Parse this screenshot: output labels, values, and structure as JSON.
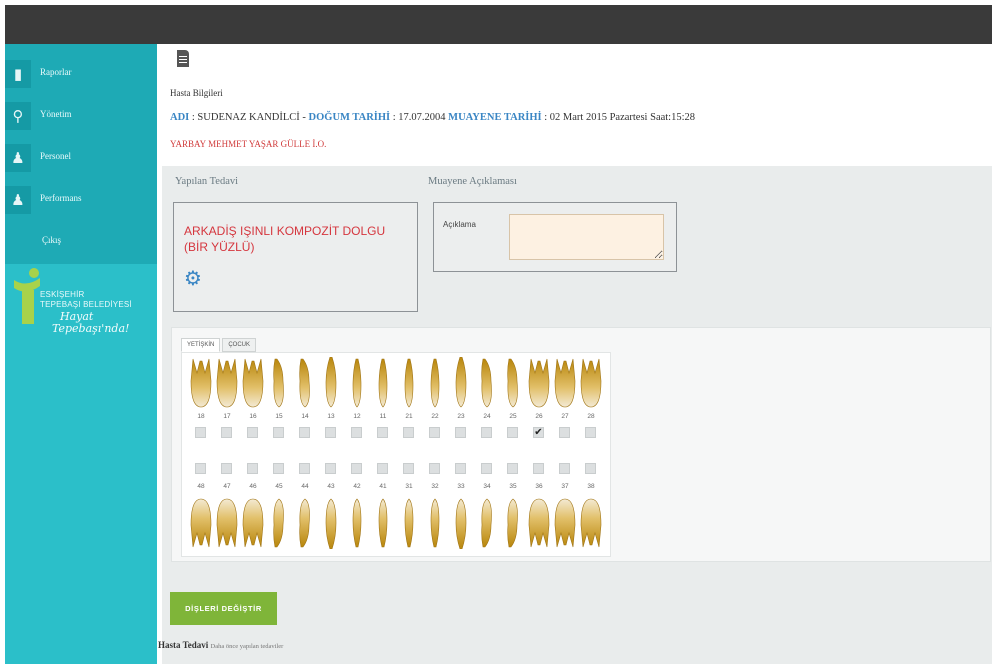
{
  "sidebar": {
    "items": [
      {
        "label": "Raporlar",
        "icon": "document-icon"
      },
      {
        "label": "Yönetim",
        "icon": "key-icon"
      },
      {
        "label": "Personel",
        "icon": "user-group-icon"
      },
      {
        "label": "Performans",
        "icon": "user-group-icon"
      },
      {
        "label": "Çıkış",
        "icon": ""
      }
    ],
    "logo": {
      "line1": "ESKİŞEHİR",
      "line2": "TEPEBAŞI BELEDİYESİ",
      "script1": "Hayat",
      "script2": "Tepebaşı'nda!"
    }
  },
  "patient": {
    "section_title": "Hasta Bilgileri",
    "name_label": "ADI",
    "name_value": " : SUDENAZ KANDİLCİ - ",
    "birth_label": "DOĞUM TARİHİ",
    "birth_value": " : 17.07.2004 ",
    "exam_label": "MUAYENE TARİHİ",
    "exam_value": " : 02 Mart 2015 Pazartesi Saat:15:28",
    "clinic": "YARBAY MEHMET YAŞAR GÜLLE İ.O."
  },
  "treatment": {
    "section_label": "Yapılan Tedavi",
    "text": "ARKADİŞ IŞINLI KOMPOZİT DOLGU (BİR YÜZLÜ)"
  },
  "exam_notes": {
    "section_label": "Muayene Açıklaması",
    "field_label": "Açıklama",
    "value": ""
  },
  "teeth": {
    "tabs": [
      {
        "label": "YETİŞKİN",
        "active": true
      },
      {
        "label": "ÇOCUK",
        "active": false
      }
    ],
    "upper": [
      {
        "num": "18",
        "checked": false,
        "shape": "molar"
      },
      {
        "num": "17",
        "checked": false,
        "shape": "molar"
      },
      {
        "num": "16",
        "checked": false,
        "shape": "molar"
      },
      {
        "num": "15",
        "checked": false,
        "shape": "premolar"
      },
      {
        "num": "14",
        "checked": false,
        "shape": "premolar"
      },
      {
        "num": "13",
        "checked": false,
        "shape": "canine"
      },
      {
        "num": "12",
        "checked": false,
        "shape": "incisor"
      },
      {
        "num": "11",
        "checked": false,
        "shape": "incisor"
      },
      {
        "num": "21",
        "checked": false,
        "shape": "incisor"
      },
      {
        "num": "22",
        "checked": false,
        "shape": "incisor"
      },
      {
        "num": "23",
        "checked": false,
        "shape": "canine"
      },
      {
        "num": "24",
        "checked": false,
        "shape": "premolar"
      },
      {
        "num": "25",
        "checked": false,
        "shape": "premolar"
      },
      {
        "num": "26",
        "checked": true,
        "shape": "molar"
      },
      {
        "num": "27",
        "checked": false,
        "shape": "molar"
      },
      {
        "num": "28",
        "checked": false,
        "shape": "molar"
      }
    ],
    "lower": [
      {
        "num": "48",
        "checked": false,
        "shape": "molar"
      },
      {
        "num": "47",
        "checked": false,
        "shape": "molar"
      },
      {
        "num": "46",
        "checked": false,
        "shape": "molar"
      },
      {
        "num": "45",
        "checked": false,
        "shape": "premolar"
      },
      {
        "num": "44",
        "checked": false,
        "shape": "premolar"
      },
      {
        "num": "43",
        "checked": false,
        "shape": "canine"
      },
      {
        "num": "42",
        "checked": false,
        "shape": "incisor"
      },
      {
        "num": "41",
        "checked": false,
        "shape": "incisor"
      },
      {
        "num": "31",
        "checked": false,
        "shape": "incisor"
      },
      {
        "num": "32",
        "checked": false,
        "shape": "incisor"
      },
      {
        "num": "33",
        "checked": false,
        "shape": "canine"
      },
      {
        "num": "34",
        "checked": false,
        "shape": "premolar"
      },
      {
        "num": "35",
        "checked": false,
        "shape": "premolar"
      },
      {
        "num": "36",
        "checked": false,
        "shape": "molar"
      },
      {
        "num": "37",
        "checked": false,
        "shape": "molar"
      },
      {
        "num": "38",
        "checked": false,
        "shape": "molar"
      }
    ]
  },
  "actions": {
    "change_teeth_label": "DİŞLERİ DEĞİŞTİR"
  },
  "footer": {
    "title": "Hasta Tedavi",
    "subtitle": "Daha önce yapılan tedaviler"
  },
  "colors": {
    "topbar": "#3a3a3a",
    "sidebar": "#2bbfc9",
    "sidebar_menu": "#1eaab5",
    "accent_blue": "#3a86c4",
    "treatment_red": "#d5363e",
    "button_green": "#7fb539"
  }
}
